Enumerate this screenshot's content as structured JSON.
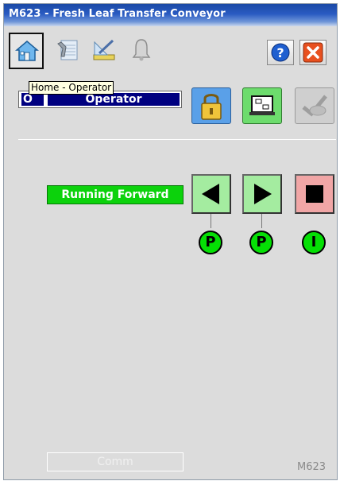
{
  "window": {
    "title": "M623 - Fresh Leaf Transfer Conveyor"
  },
  "toolbar": {
    "tabs": [
      {
        "name": "home",
        "icon": "home-icon"
      },
      {
        "name": "maintenance",
        "icon": "maintenance-icon"
      },
      {
        "name": "engineering",
        "icon": "engineering-icon"
      },
      {
        "name": "alarms",
        "icon": "bell-icon"
      }
    ],
    "help_icon": "help-icon",
    "close_icon": "close-icon",
    "tooltip": "Home - Operator"
  },
  "mode": {
    "letter": "O",
    "text": "Operator"
  },
  "buttons": {
    "lock_icon": "lock-icon",
    "faceplate_icon": "faceplate-icon",
    "acknowledge_icon": "acknowledge-icon"
  },
  "motor": {
    "status": "Running Forward",
    "reverse_icon": "arrow-left-icon",
    "forward_icon": "arrow-right-icon",
    "stop_icon": "stop-icon",
    "indicators": [
      "P",
      "P",
      "I"
    ]
  },
  "footer": {
    "comm_label": "Comm",
    "tag_name": "M623"
  },
  "colors": {
    "title_bar": "#2a5bc2",
    "mode_background": "#000080",
    "status_running": "#0cd20c",
    "badge": "#05e005",
    "command_green": "#a4eca0",
    "command_red": "#f1a6a6"
  }
}
